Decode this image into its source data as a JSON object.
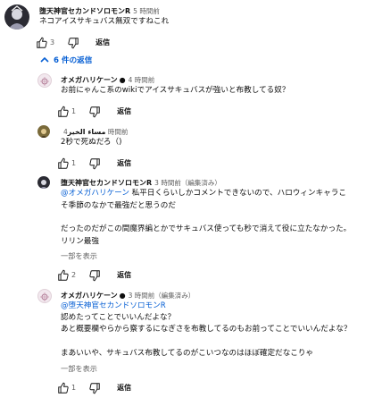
{
  "top_comment": {
    "author": "堕天神官セカンドソロモンR",
    "time": "5 時間前",
    "text": "ネコアイスサキュバス無双ですねこれ",
    "likes": "3",
    "reply_label": "返信"
  },
  "replies_toggle": {
    "label": "6 件の返信",
    "icon": "chevron-up-icon"
  },
  "replies": [
    {
      "author": "オメガハリケーン",
      "time": "4 時間前",
      "lines": [
        "お前にゃんこ系のwikiでアイスサキュバスが強いと布教してる奴？"
      ],
      "likes": "1",
      "reply_label": "返信"
    },
    {
      "author": "مساء الخير",
      "time": "4 時間前",
      "lines": [
        "2秒で死ぬだろ（)"
      ],
      "likes": "1",
      "reply_label": "返信"
    },
    {
      "author": "堕天神官セカンドソロモンR",
      "time": "3 時間前（編集済み）",
      "mention": "@オメガハリケーン",
      "lines": [
        "私平日くらいしかコメントできないので、ハロウィンキャラこ",
        "そ季節のなかで最強だと思うのだ",
        "",
        "だったのだがこの間魔界編とかでサキュバス使っても秒で消えて役に立たなかった。",
        "リリン最強"
      ],
      "show_more": "一部を表示",
      "likes": "2",
      "reply_label": "返信"
    },
    {
      "author": "オメガハリケーン",
      "time": "3 時間前（編集済み）",
      "mention": "@堕天神官セカンドソロモンR",
      "lines": [
        "認めたってことでいいんだよな？",
        "あと概要欄やらから察するになぎさを布教してるのもお前ってことでいいんだよな？",
        "",
        "まあいいや、サキュバス布教してるのがこいつなのはほぼ確定だなこりゃ"
      ],
      "show_more": "一部を表示",
      "likes": "1",
      "reply_label": "返信"
    }
  ]
}
